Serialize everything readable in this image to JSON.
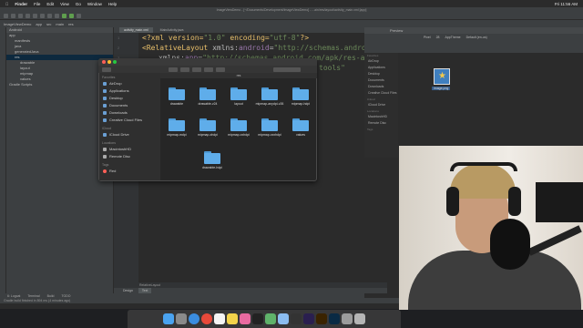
{
  "menubar": {
    "apple": "",
    "app": "Finder",
    "items": [
      "File",
      "Edit",
      "View",
      "Go",
      "Window",
      "Help"
    ],
    "clock": "Fri 11:56 AM"
  },
  "ide": {
    "window_title": "ImageViewDemo - [~/Documents/Development/ImageViewDemo] - ...ain/res/layout/activity_main.xml [app]",
    "nav": [
      "ImageViewDemo",
      "app",
      "src",
      "main",
      "res"
    ],
    "project_header": "Android",
    "tree": [
      {
        "label": "app",
        "indent": 0
      },
      {
        "label": "manifests",
        "indent": 1
      },
      {
        "label": "java",
        "indent": 1
      },
      {
        "label": "generatedJava",
        "indent": 1
      },
      {
        "label": "res",
        "indent": 1,
        "selected": true
      },
      {
        "label": "drawable",
        "indent": 2
      },
      {
        "label": "layout",
        "indent": 2
      },
      {
        "label": "mipmap",
        "indent": 2
      },
      {
        "label": "values",
        "indent": 2
      },
      {
        "label": "Gradle Scripts",
        "indent": 0
      }
    ],
    "editor_tabs": [
      {
        "label": "activity_main.xml",
        "active": true
      },
      {
        "label": "MainActivity.java",
        "active": false
      }
    ],
    "code": {
      "line1_a": "<?xml version=",
      "line1_b": "\"1.0\"",
      "line1_c": " encoding=",
      "line1_d": "\"utf-8\"",
      "line1_e": "?>",
      "line2_a": "<RelativeLayout ",
      "line2_b": "xmlns:",
      "line2_c": "android",
      "line2_d": "=",
      "line2_e": "\"http://schemas.android.co",
      "line3_a": "xmlns:",
      "line3_b": "app",
      "line3_c": "=",
      "line3_d": "\"http://schemas.android.com/apk/res-auto\"",
      "line4": "tools\""
    },
    "line_numbers": [
      "1",
      "2",
      "3",
      "4"
    ],
    "editor_bottom_tabs": [
      {
        "label": "Design",
        "active": false
      },
      {
        "label": "Text",
        "active": true
      }
    ],
    "breadcrumb_bottom": "RelativeLayout",
    "bottom_tools": [
      "6: Logcat",
      "Terminal",
      "Build",
      "TODO",
      "6: Logcat"
    ],
    "status": "Gradle build finished in 894 ms (4 minutes ago)",
    "preview": {
      "title": "Preview",
      "toolbar": [
        "Pixel",
        "28",
        "AppTheme",
        "Default (en-us)"
      ]
    },
    "side_tools_left": [
      "1: Project",
      "2: Structure",
      "Favorites",
      "Build Variants",
      "Layout Captures"
    ]
  },
  "ide_finder": {
    "favorites_title": "Favorites",
    "favorites": [
      "AirDrop",
      "Applications",
      "Desktop",
      "Documents",
      "Downloads",
      "Creative Cloud Files"
    ],
    "icloud_title": "iCloud",
    "icloud": [
      "iCloud Drive"
    ],
    "locations_title": "Locations",
    "locations": [
      "MacintoshHD",
      "Remote Disc"
    ],
    "tags_title": "Tags",
    "file_label": "image.png"
  },
  "finder": {
    "path_title": "res",
    "sidebar": {
      "favorites_title": "Favorites",
      "favorites": [
        "AirDrop",
        "Applications",
        "Desktop",
        "Documents",
        "Downloads",
        "Creative Cloud Files"
      ],
      "icloud_title": "iCloud",
      "icloud": [
        "iCloud Drive"
      ],
      "locations_title": "Locations",
      "locations": [
        "MacintoshHD",
        "Remote Disc"
      ],
      "tags_title": "Tags",
      "tags": [
        "Red"
      ]
    },
    "folders": [
      "drawable",
      "drawable-v24",
      "layout",
      "mipmap-anydpi-v26",
      "mipmap-hdpi",
      "mipmap-mdpi",
      "mipmap-xhdpi",
      "mipmap-xxhdpi",
      "mipmap-xxxhdpi",
      "values",
      "drawable-hdpi"
    ]
  },
  "colors": {
    "folder": "#5fadea",
    "folder_tab": "#4c98d3",
    "selection": "#0d293e",
    "ide_bg": "#2b2b2b"
  },
  "dock": {
    "apps": [
      "finder-icon",
      "launchpad-icon",
      "safari-icon",
      "chrome-icon",
      "calendar-icon",
      "notes-icon",
      "photos-icon",
      "terminal-icon",
      "android-studio-icon",
      "preview-icon",
      "final-cut-icon",
      "premiere-icon",
      "illustrator-icon",
      "photoshop-icon",
      "system-preferences-icon",
      "trash-icon"
    ]
  }
}
